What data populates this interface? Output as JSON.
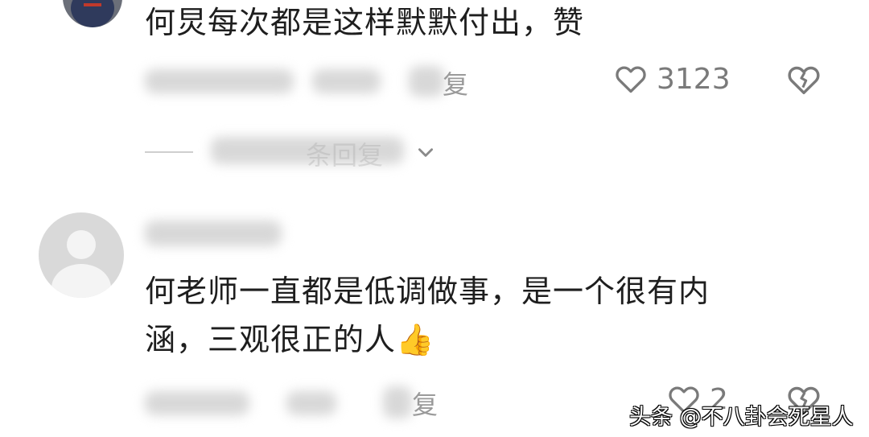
{
  "comment1": {
    "text": "何炅每次都是这样默默付出，赞",
    "reply_label": "复",
    "like_count": "3123",
    "thread_toggle": "条回复"
  },
  "comment2": {
    "text_line1": "何老师一直都是低调做事，是一个很有内",
    "text_line2": "涵，三观很正的人",
    "emoji": "👍",
    "reply_label": "复",
    "like_count": "2"
  },
  "watermark": {
    "text": "头条 @不八卦会死星人"
  },
  "colors": {
    "text": "#1e1e1e",
    "meta": "#9a9a9a",
    "icon": "#7a7a7a",
    "avatar_bg": "#d9d9d9"
  }
}
